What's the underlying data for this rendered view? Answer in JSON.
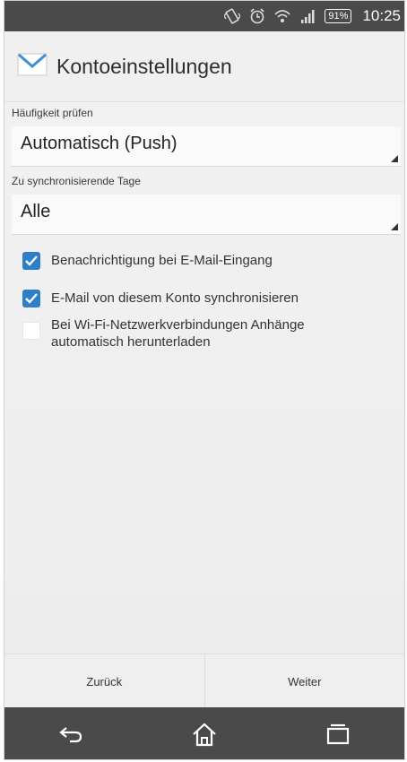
{
  "status_bar": {
    "icons": [
      "vibrate-icon",
      "alarm-icon",
      "wifi-icon",
      "signal-icon"
    ],
    "battery": "91%",
    "time": "10:25"
  },
  "header": {
    "icon": "email-envelope-icon",
    "title": "Kontoeinstellungen"
  },
  "settings": {
    "check_frequency": {
      "label": "Häufigkeit prüfen",
      "value": "Automatisch (Push)"
    },
    "sync_days": {
      "label": "Zu synchronisierende Tage",
      "value": "Alle"
    },
    "options": [
      {
        "label": "Benachrichtigung bei E-Mail-Eingang",
        "checked": true
      },
      {
        "label": "E-Mail von diesem Konto synchronisieren",
        "checked": true
      },
      {
        "label": "Bei Wi-Fi-Netzwerkverbindungen Anhänge automatisch herunterladen",
        "checked": false
      }
    ]
  },
  "buttons": {
    "back": "Zurück",
    "next": "Weiter"
  },
  "nav_bar": {
    "icons": [
      "back-icon",
      "home-icon",
      "recent-apps-icon"
    ]
  },
  "colors": {
    "accent": "#2f7fc8",
    "bar_dark": "#4a4a4a"
  }
}
